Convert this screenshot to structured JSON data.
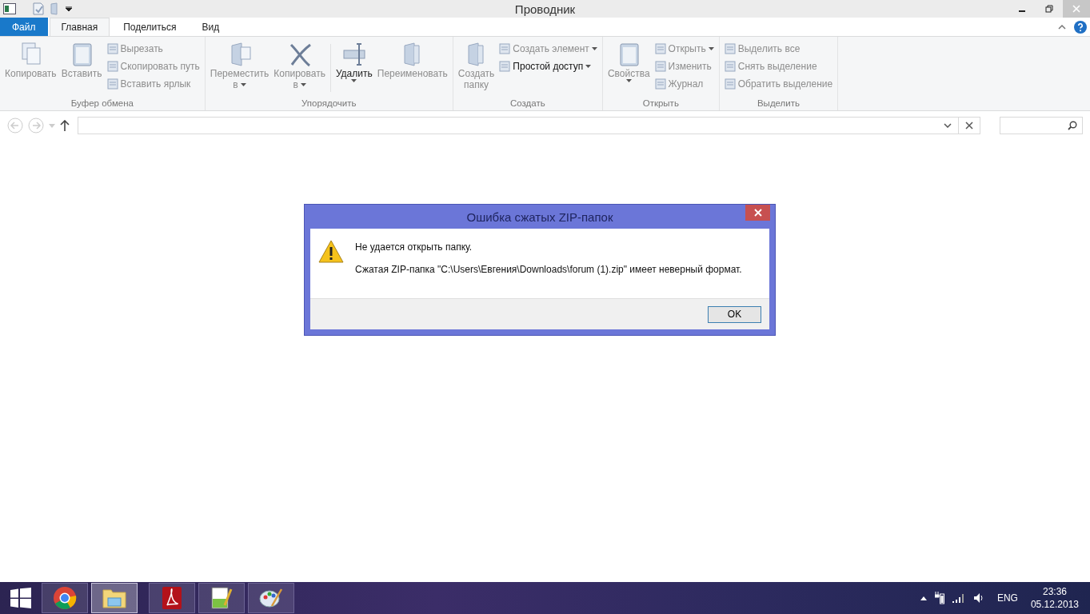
{
  "window": {
    "title": "Проводник"
  },
  "ribbon": {
    "tabs": [
      {
        "label": "Файл",
        "kind": "file",
        "selected": false
      },
      {
        "label": "Главная",
        "kind": "tab",
        "selected": true
      },
      {
        "label": "Поделиться",
        "kind": "tab",
        "selected": false
      },
      {
        "label": "Вид",
        "kind": "tab",
        "selected": false
      }
    ],
    "groups": [
      {
        "label": "Буфер обмена",
        "items": [
          {
            "kind": "large",
            "lines": [
              "Копировать"
            ],
            "disabled": true,
            "dropdown": false
          },
          {
            "kind": "large",
            "lines": [
              "Вставить"
            ],
            "disabled": true,
            "dropdown": false
          },
          {
            "kind": "small",
            "lines": [
              "Вырезать"
            ],
            "disabled": true,
            "dropdown": false
          },
          {
            "kind": "small",
            "lines": [
              "Скопировать путь"
            ],
            "disabled": true,
            "dropdown": false
          },
          {
            "kind": "small",
            "lines": [
              "Вставить ярлык"
            ],
            "disabled": true,
            "dropdown": false
          }
        ]
      },
      {
        "label": "Упорядочить",
        "items": [
          {
            "kind": "large",
            "lines": [
              "Переместить",
              "в"
            ],
            "disabled": true,
            "dropdown": true
          },
          {
            "kind": "large",
            "lines": [
              "Копировать",
              "в"
            ],
            "disabled": true,
            "dropdown": true
          },
          {
            "kind": "separator"
          },
          {
            "kind": "large",
            "lines": [
              "Удалить"
            ],
            "disabled": false,
            "dropdown": true
          },
          {
            "kind": "large",
            "lines": [
              "Переименовать"
            ],
            "disabled": true,
            "dropdown": false
          }
        ]
      },
      {
        "label": "Создать",
        "items": [
          {
            "kind": "large",
            "lines": [
              "Создать",
              "папку"
            ],
            "disabled": true,
            "dropdown": false
          },
          {
            "kind": "small",
            "lines": [
              "Создать элемент"
            ],
            "disabled": true,
            "dropdown": true
          },
          {
            "kind": "small",
            "lines": [
              "Простой доступ"
            ],
            "disabled": false,
            "dropdown": true
          }
        ]
      },
      {
        "label": "Открыть",
        "items": [
          {
            "kind": "large",
            "lines": [
              "Свойства"
            ],
            "disabled": true,
            "dropdown": true
          },
          {
            "kind": "small",
            "lines": [
              "Открыть"
            ],
            "disabled": true,
            "dropdown": true
          },
          {
            "kind": "small",
            "lines": [
              "Изменить"
            ],
            "disabled": true,
            "dropdown": false
          },
          {
            "kind": "small",
            "lines": [
              "Журнал"
            ],
            "disabled": true,
            "dropdown": false
          }
        ]
      },
      {
        "label": "Выделить",
        "items": [
          {
            "kind": "small",
            "lines": [
              "Выделить все"
            ],
            "disabled": true,
            "dropdown": false
          },
          {
            "kind": "small",
            "lines": [
              "Снять выделение"
            ],
            "disabled": true,
            "dropdown": false
          },
          {
            "kind": "small",
            "lines": [
              "Обратить выделение"
            ],
            "disabled": true,
            "dropdown": false
          }
        ]
      }
    ]
  },
  "dialog": {
    "title": "Ошибка сжатых ZIP-папок",
    "heading": "Не удается открыть папку.",
    "message": "Сжатая ZIP-папка \"C:\\Users\\Евгения\\Downloads\\forum (1).zip\" имеет неверный формат.",
    "button": "OK"
  },
  "taskbar": {
    "apps": [
      {
        "kind": "browser",
        "selected": false
      },
      {
        "kind": "explorer",
        "selected": true
      },
      {
        "kind": "pdf",
        "selected": false
      },
      {
        "kind": "notepad",
        "selected": false
      },
      {
        "kind": "paint",
        "selected": false
      }
    ],
    "language": "ENG",
    "time": "23:36",
    "date": "05.12.2013"
  }
}
